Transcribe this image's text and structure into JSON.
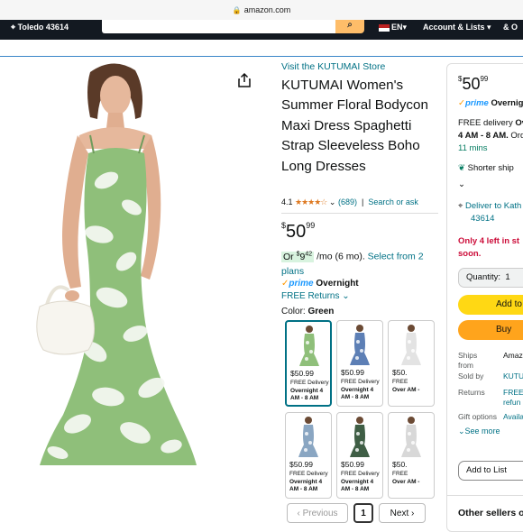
{
  "browser": {
    "url": "amazon.com"
  },
  "nav": {
    "location": "Toledo 43614",
    "language": "EN",
    "account": "Account & Lists",
    "returns": "& O"
  },
  "product": {
    "store_link": "Visit the KUTUMAI Store",
    "title": "KUTUMAI Women's Summer Floral Bodycon Maxi Dress Spaghetti Strap Sleeveless Boho Long Dresses",
    "rating": "4.1",
    "review_count": "(689)",
    "search_ask": "Search or ask",
    "price_whole": "50",
    "price_fraction": "99",
    "installment_prefix": "Or",
    "installment_whole": "9",
    "installment_fraction": "42",
    "installment_suffix": "/mo (6 mo).",
    "installment_link": "Select from 2 plans",
    "prime_label": "prime",
    "prime_overnight": "Overnight",
    "free_returns": "FREE Returns",
    "color_label": "Color:",
    "color_value": "Green"
  },
  "swatches": [
    {
      "price": "$50.99",
      "delivery": "FREE Delivery",
      "overnight": "Overnight 4 AM - 8 AM",
      "selected": true,
      "color": "#8fbf7a"
    },
    {
      "price": "$50.99",
      "delivery": "FREE Delivery",
      "overnight": "Overnight 4 AM - 8 AM",
      "selected": false,
      "color": "#5d7fb5"
    },
    {
      "price": "$50.",
      "delivery": "FREE",
      "overnight": "Over AM -",
      "selected": false,
      "color": "#e3e3e3"
    },
    {
      "price": "$50.99",
      "delivery": "FREE Delivery",
      "overnight": "Overnight 4 AM - 8 AM",
      "selected": false,
      "color": "#8aa6c2"
    },
    {
      "price": "$50.99",
      "delivery": "FREE Delivery",
      "overnight": "Overnight 4 AM - 8 AM",
      "selected": false,
      "color": "#3f5e45"
    },
    {
      "price": "$50.",
      "delivery": "FREE",
      "overnight": "Over AM -",
      "selected": false,
      "color": "#d8d8d8"
    }
  ],
  "pagination": {
    "previous": "Previous",
    "page": "1",
    "next": "Next"
  },
  "buybox": {
    "price_whole": "50",
    "price_fraction": "99",
    "prime": "prime",
    "overnight": "Overnight",
    "free_delivery": "FREE delivery",
    "delivery_bold": "Ov",
    "window": "4 AM - 8 AM.",
    "order_within": "Ord",
    "countdown": "11 mins",
    "shorter_ship": "Shorter ship",
    "deliver_to": "Deliver to Kath",
    "zip": "43614",
    "stock_line1": "Only 4 left in st",
    "stock_line2": "soon.",
    "quantity_label": "Quantity:",
    "quantity_value": "1",
    "add_to_cart": "Add to",
    "buy_now": "Buy",
    "ships_from_label": "Ships from",
    "ships_from_value": "Amaz",
    "sold_by_label": "Sold by",
    "sold_by_value": "KUTU",
    "returns_label": "Returns",
    "returns_value": "FREE refun",
    "gift_label": "Gift options",
    "gift_value": "Availa",
    "see_more": "See more",
    "add_to_list": "Add to List",
    "other_sellers": "Other sellers o"
  },
  "colors": {
    "nav_dark": "#131921",
    "link_teal": "#007185",
    "add_to_cart_yellow": "#ffd814",
    "buy_now_orange": "#ffa41c",
    "stock_red": "#cc0c39",
    "delivery_green": "#067d62",
    "dress_green": "#8fbf7a"
  }
}
